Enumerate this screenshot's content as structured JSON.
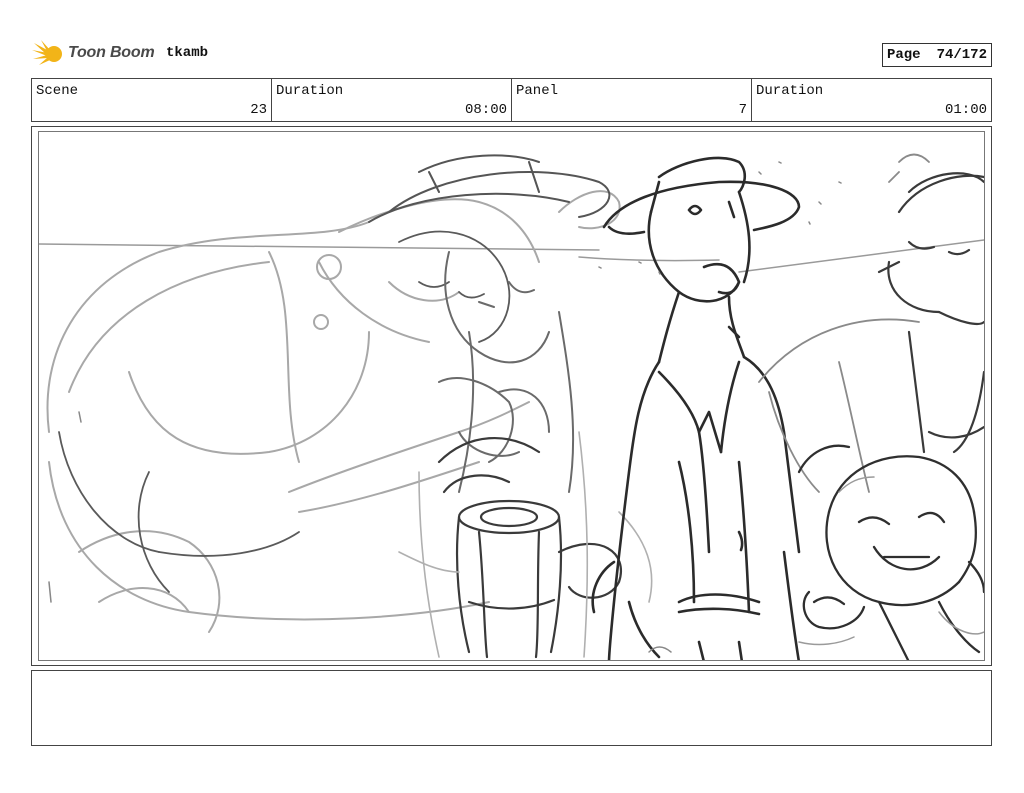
{
  "header": {
    "logo_text": "Toon Boom",
    "project": "tkamb",
    "page_label": "Page",
    "page_number": "74/172"
  },
  "info": {
    "scene_label": "Scene",
    "scene_value": "23",
    "scene_duration_label": "Duration",
    "scene_duration_value": "08:00",
    "panel_label": "Panel",
    "panel_value": "7",
    "panel_duration_label": "Duration",
    "panel_duration_value": "01:00"
  },
  "colors": {
    "logo_accent": "#f2b418",
    "sketch_dark": "#2b2b2b",
    "sketch_light": "#a8a8a8"
  }
}
